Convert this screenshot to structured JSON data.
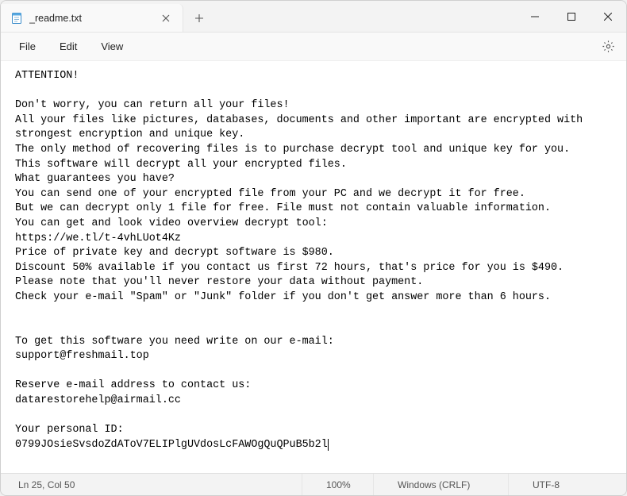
{
  "window": {
    "tab_title": "_readme.txt",
    "menus": {
      "file": "File",
      "edit": "Edit",
      "view": "View"
    }
  },
  "content": {
    "text": "ATTENTION!\n\nDon't worry, you can return all your files!\nAll your files like pictures, databases, documents and other important are encrypted with strongest encryption and unique key.\nThe only method of recovering files is to purchase decrypt tool and unique key for you.\nThis software will decrypt all your encrypted files.\nWhat guarantees you have?\nYou can send one of your encrypted file from your PC and we decrypt it for free.\nBut we can decrypt only 1 file for free. File must not contain valuable information.\nYou can get and look video overview decrypt tool:\nhttps://we.tl/t-4vhLUot4Kz\nPrice of private key and decrypt software is $980.\nDiscount 50% available if you contact us first 72 hours, that's price for you is $490.\nPlease note that you'll never restore your data without payment.\nCheck your e-mail \"Spam\" or \"Junk\" folder if you don't get answer more than 6 hours.\n\n\nTo get this software you need write on our e-mail:\nsupport@freshmail.top\n\nReserve e-mail address to contact us:\ndatarestorehelp@airmail.cc\n\nYour personal ID:\n0799JOsieSvsdoZdAToV7ELIPlgUVdosLcFAWOgQuQPuB5b2l"
  },
  "statusbar": {
    "position": "Ln 25, Col 50",
    "zoom": "100%",
    "line_ending": "Windows (CRLF)",
    "encoding": "UTF-8"
  }
}
